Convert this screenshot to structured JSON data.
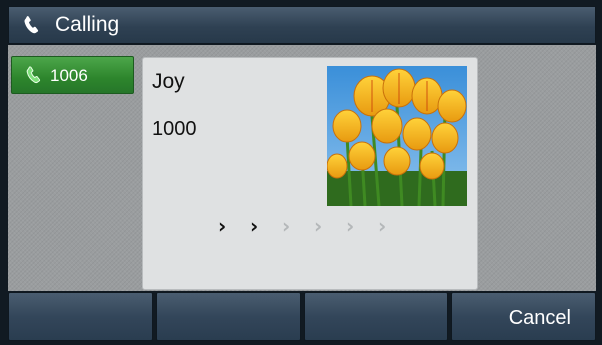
{
  "titlebar": {
    "title": "Calling",
    "icon": "phone-handset-icon"
  },
  "line": {
    "label": "1006",
    "icon": "green-phone-icon",
    "color": "#2d852c"
  },
  "call": {
    "name": "Joy",
    "number": "1000",
    "photo": "tulip-contact-photo",
    "progress": {
      "total": 6,
      "active": 2,
      "symbol": "›"
    }
  },
  "softkeys": [
    "",
    "",
    "",
    "Cancel"
  ]
}
